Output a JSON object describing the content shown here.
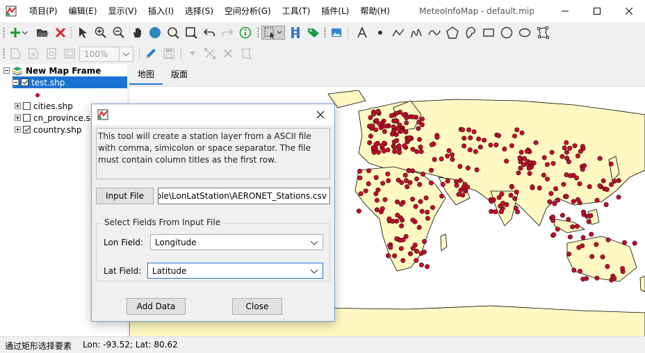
{
  "app": {
    "title": "MeteoInfoMap - default.mip",
    "menu": [
      "项目(P)",
      "编辑(E)",
      "显示(V)",
      "插入(I)",
      "选择(S)",
      "空间分析(G)",
      "工具(T)",
      "插件(L)",
      "帮助(H)"
    ]
  },
  "toolbar": {
    "zoom_value": "100%"
  },
  "tree": {
    "root_label": "New Map Frame",
    "layers": [
      {
        "label": "test.shp",
        "checked": true,
        "selected": true
      },
      {
        "label": "cities.shp",
        "checked": false,
        "selected": false
      },
      {
        "label": "cn_province.shp",
        "checked": false,
        "selected": false
      },
      {
        "label": "country.shp",
        "checked": true,
        "selected": false
      }
    ]
  },
  "tabs": {
    "map": "地图",
    "layout": "版面"
  },
  "status": {
    "message": "通过矩形选择要素",
    "coords": "Lon: -93.52; Lat: 80.62"
  },
  "dialog": {
    "description": "This tool will create a station layer from a ASCII file with comma, simicolon or space separator. The file must contain column titles as the first row.",
    "input_file_label": "Input File",
    "input_file_path": "ple\\LonLatStation\\AERONET_Stations.csv",
    "group_title": "Select Fields From Input File",
    "lon_label": "Lon Field:",
    "lon_value": "Longitude",
    "lat_label": "Lat Field:",
    "lat_value": "Latitude",
    "add_button": "Add Data",
    "close_button": "Close"
  },
  "colors": {
    "accent": "#1b73d1",
    "land": "#fff8c2",
    "station": "#c0102c"
  }
}
